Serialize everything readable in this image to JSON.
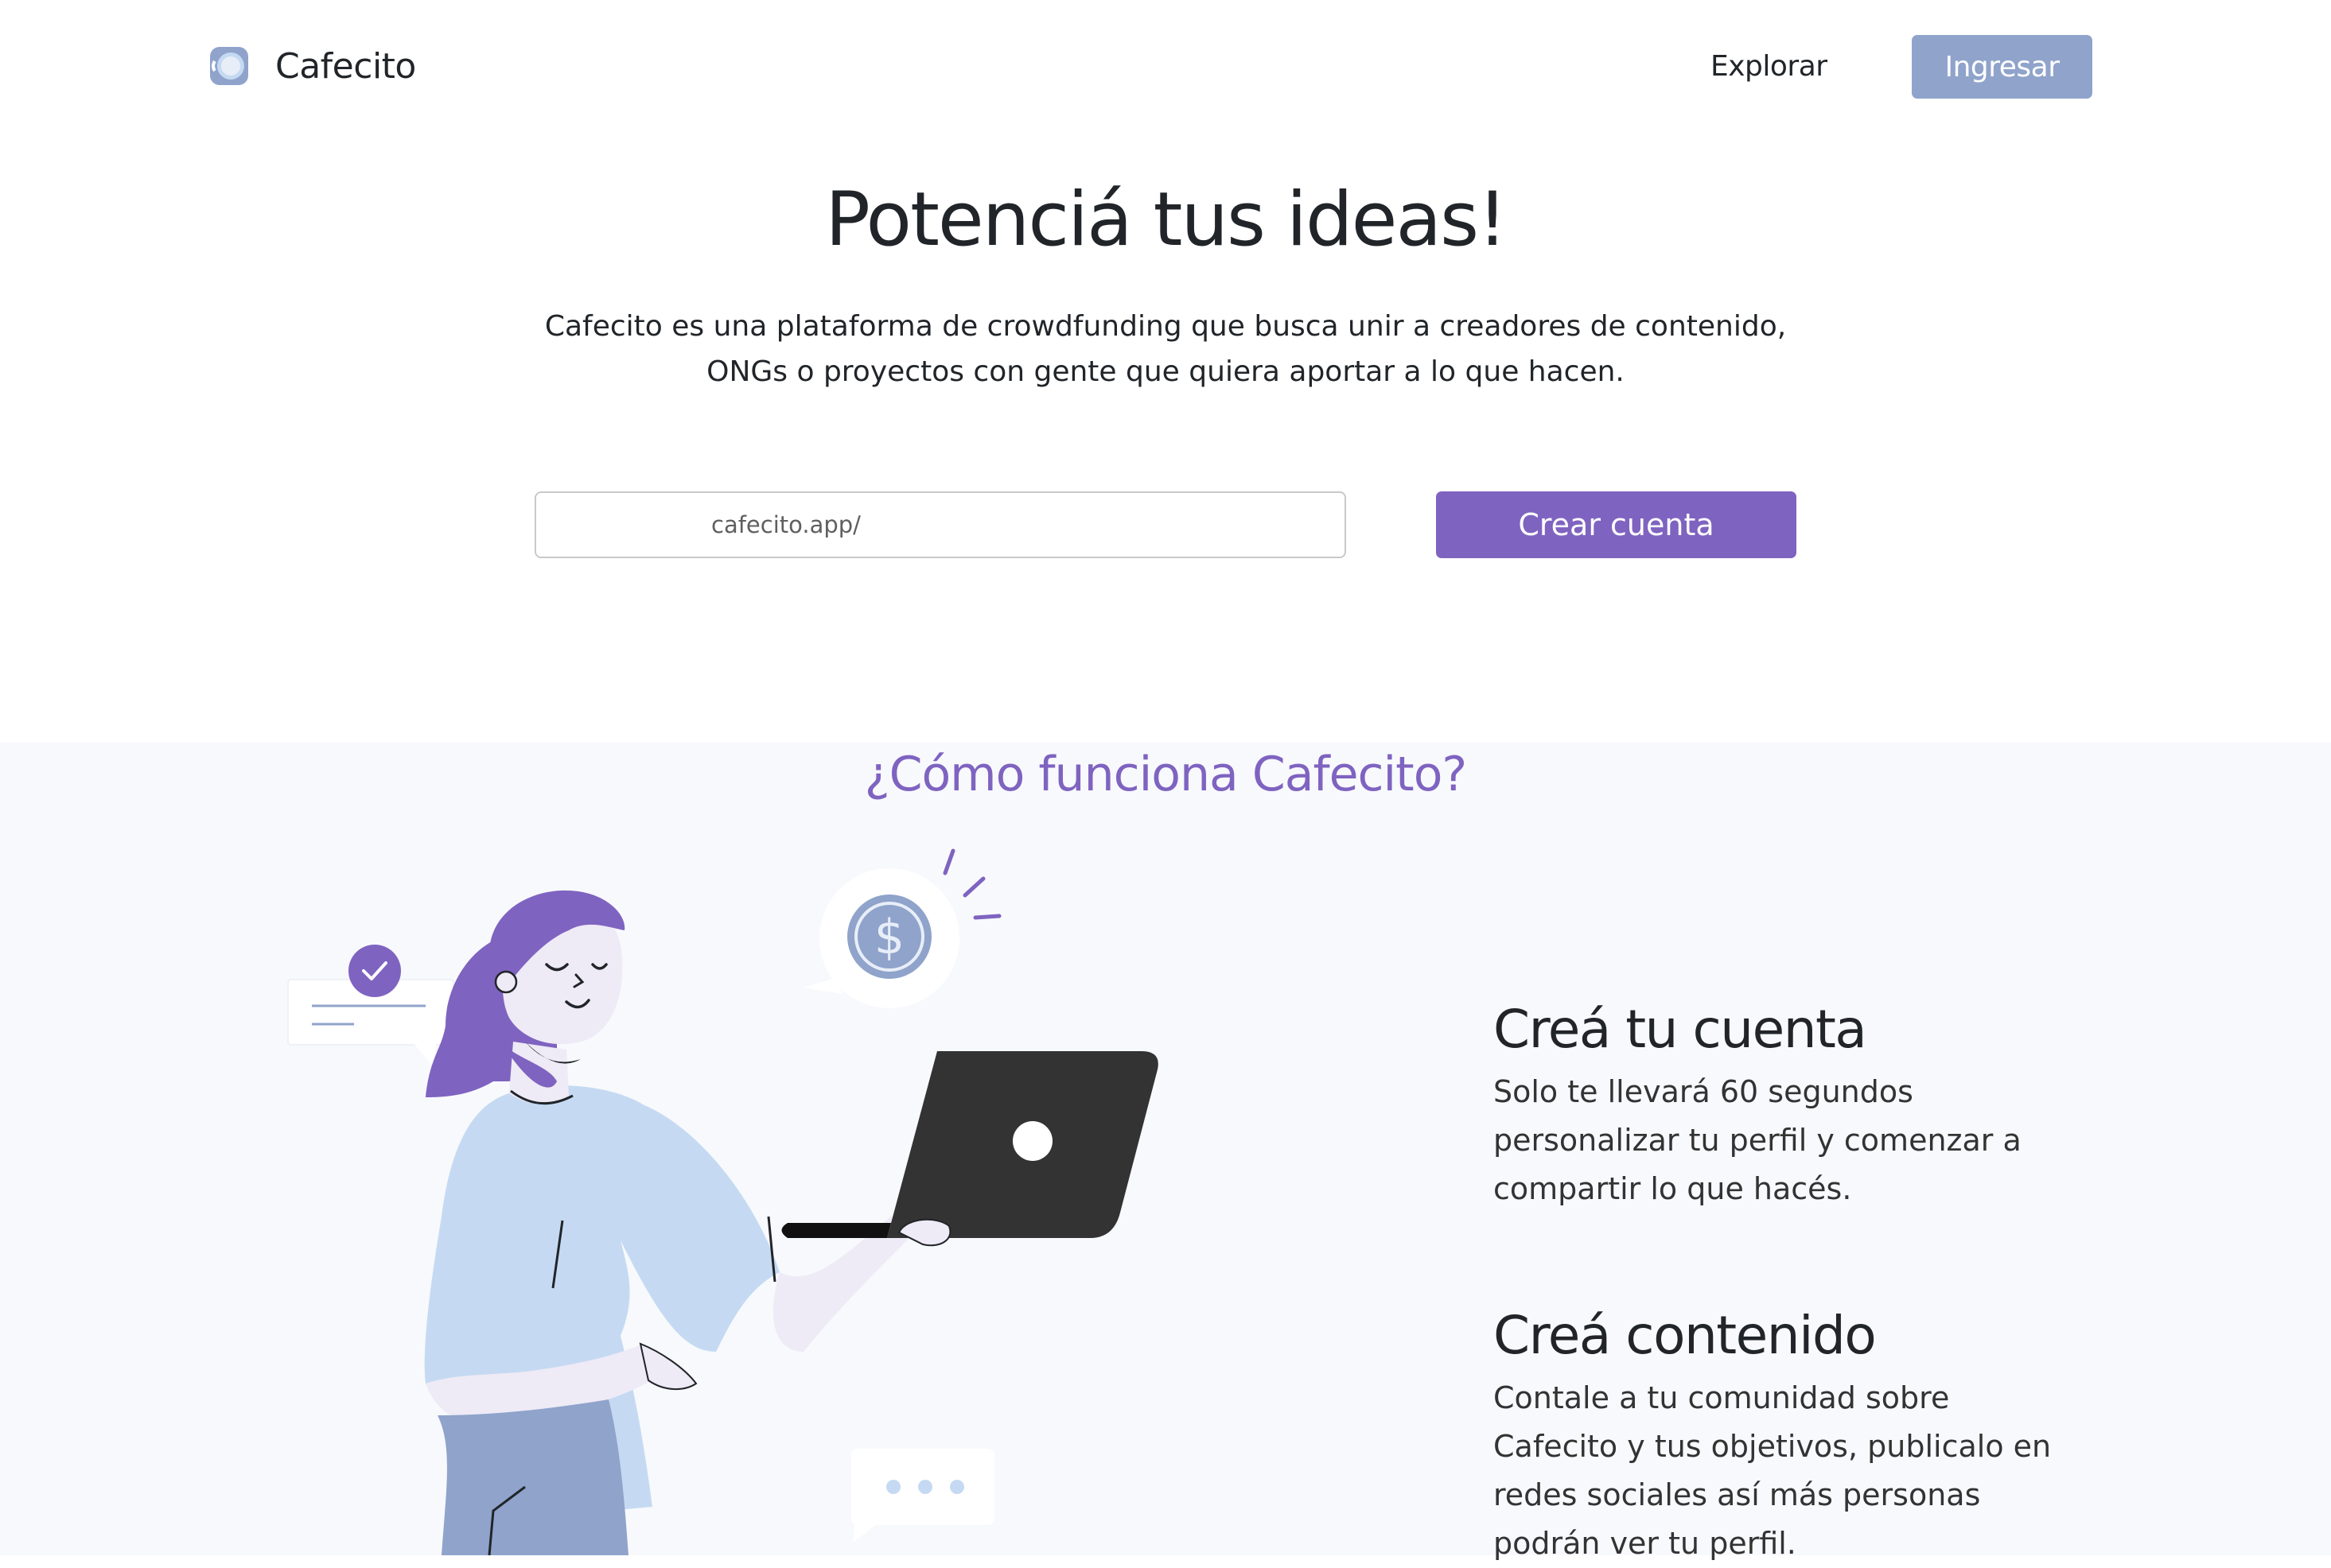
{
  "header": {
    "brand": "Cafecito",
    "nav_explore": "Explorar",
    "login": "Ingresar"
  },
  "hero": {
    "title": "Potenciá tus ideas!",
    "description": "Cafecito es una plataforma de crowdfunding que busca unir a creadores de contenido, ONGs o proyectos con gente que quiera aportar a lo que hacen.",
    "url_placeholder": "cafecito.app/",
    "cta": "Crear cuenta"
  },
  "how": {
    "title": "¿Cómo funciona Cafecito?",
    "steps": [
      {
        "title": "Creá tu cuenta",
        "text": "Solo te llevará 60 segundos personalizar tu perfil y comenzar a compartir lo que hacés."
      },
      {
        "title": "Creá contenido",
        "text": "Contale a tu comunidad sobre Cafecito y tus objetivos, publicalo en redes sociales así más personas podrán ver tu perfil."
      }
    ]
  },
  "colors": {
    "brand_purple": "#7f63c0",
    "login_blue": "#8fa3cb",
    "section_bg": "#f7f9fc",
    "shirt_blue": "#c5daf2",
    "laptop": "#333333"
  },
  "icons": {
    "logo": "coffee-cup-logo-icon",
    "coin": "dollar-coin-icon",
    "check": "check-icon"
  }
}
